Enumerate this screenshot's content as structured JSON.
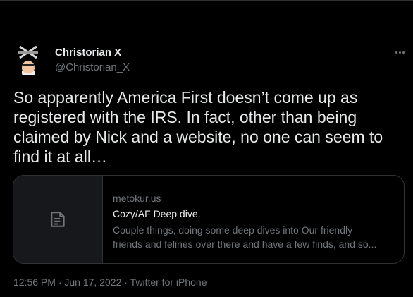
{
  "author": {
    "name": "Christorian X",
    "handle": "@Christorian_X"
  },
  "tweet": {
    "text": "So apparently America First doesn’t come up as registered with the IRS. In fact, other than being claimed by Nick and a website, no one can seem to find it at all…"
  },
  "link_card": {
    "domain": "metokur.us",
    "title": "Cozy/AF Deep dive.",
    "description_line1": "Couple things, doing some deep dives into Our friendly",
    "description_line2": "friends and felines over there and have a few finds, and so...",
    "thumbnail_icon": "document-icon"
  },
  "meta": {
    "time": "12:56 PM",
    "separator": " · ",
    "date": "Jun 17, 2022",
    "source": "Twitter for iPhone"
  },
  "colors": {
    "background": "#000000",
    "primary_text": "#e7e9ea",
    "secondary_text": "#71767b",
    "border": "#2f3336"
  }
}
